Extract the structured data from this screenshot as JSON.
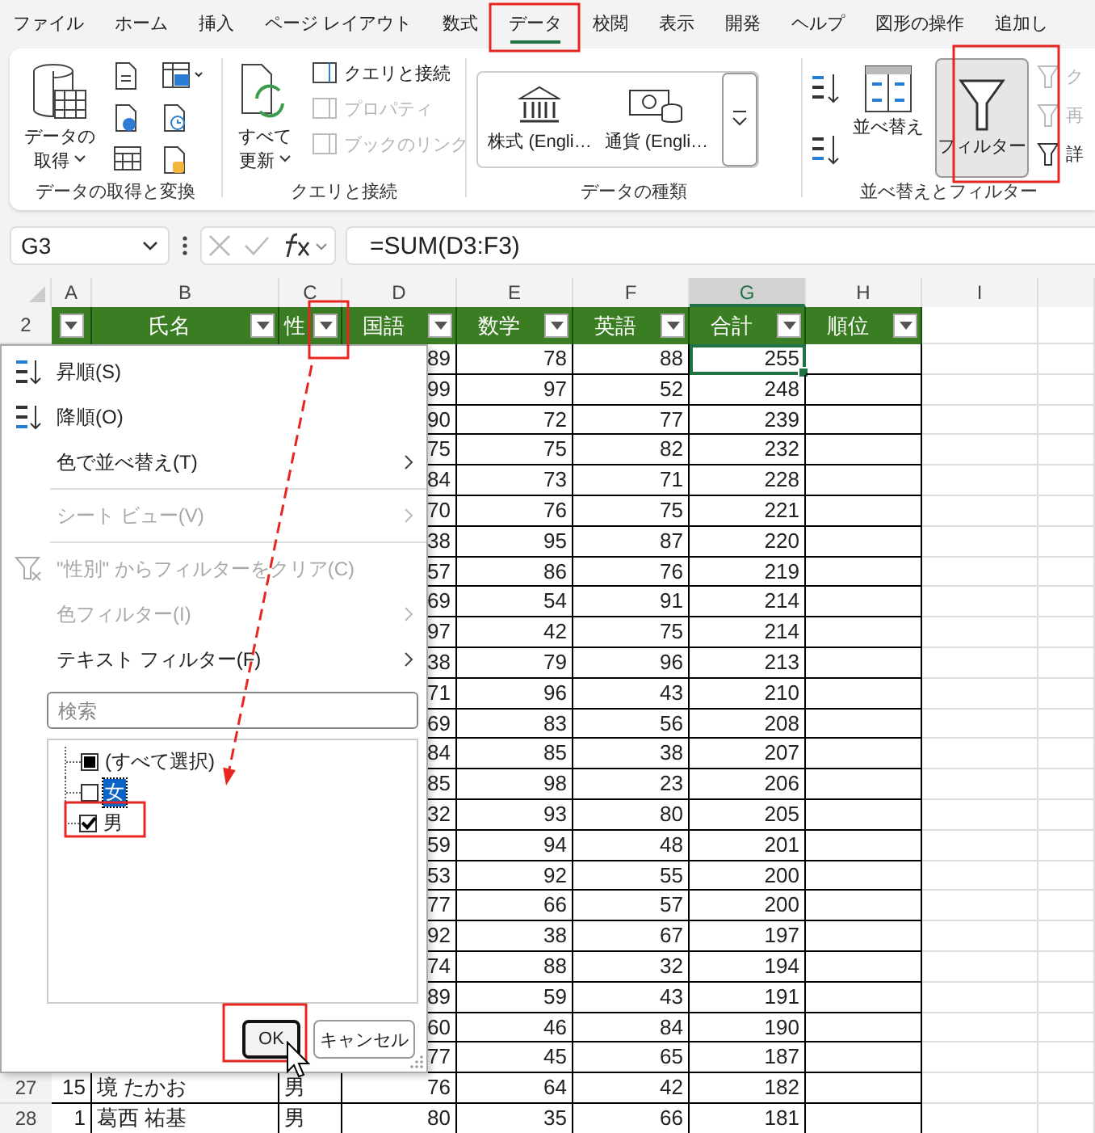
{
  "menu_tabs": [
    {
      "label": "ファイル",
      "selected": false
    },
    {
      "label": "ホーム",
      "selected": false
    },
    {
      "label": "挿入",
      "selected": false
    },
    {
      "label": "ページ レイアウト",
      "selected": false
    },
    {
      "label": "数式",
      "selected": false
    },
    {
      "label": "データ",
      "selected": true
    },
    {
      "label": "校閲",
      "selected": false
    },
    {
      "label": "表示",
      "selected": false
    },
    {
      "label": "開発",
      "selected": false
    },
    {
      "label": "ヘルプ",
      "selected": false
    },
    {
      "label": "図形の操作",
      "selected": false
    },
    {
      "label": "追加し",
      "selected": false
    }
  ],
  "ribbon": {
    "get_data_group": {
      "title": "データの取得と変換",
      "button_lines": [
        "データの",
        "取得"
      ]
    },
    "queries_group": {
      "title": "クエリと接続",
      "button_lines": [
        "すべて",
        "更新"
      ],
      "items": [
        {
          "label": "クエリと接続",
          "disabled": false
        },
        {
          "label": "プロパティ",
          "disabled": true
        },
        {
          "label": "ブックのリンク",
          "disabled": true
        }
      ]
    },
    "data_types_group": {
      "title": "データの種類",
      "types": [
        "株式 (Engli…",
        "通貨 (Engli…"
      ]
    },
    "sort_filter_group": {
      "title": "並べ替えとフィルター",
      "sort_button": "並べ替え",
      "filter_button": {
        "label": "フィルター",
        "selected": true
      },
      "side_items": [
        {
          "label": "ク",
          "disabled": true
        },
        {
          "label": "再",
          "disabled": true
        },
        {
          "label": "詳",
          "disabled": false
        }
      ]
    }
  },
  "formula_bar": {
    "name_box": "G3",
    "formula": "=SUM(D3:F3)"
  },
  "sheet": {
    "columns": [
      {
        "letter": "A",
        "selected": false
      },
      {
        "letter": "B",
        "selected": false
      },
      {
        "letter": "C",
        "selected": false
      },
      {
        "letter": "D",
        "selected": false
      },
      {
        "letter": "E",
        "selected": false
      },
      {
        "letter": "F",
        "selected": false
      },
      {
        "letter": "G",
        "selected": true
      },
      {
        "letter": "H",
        "selected": false
      },
      {
        "letter": "I",
        "selected": false
      }
    ],
    "header_row": {
      "row_number": "2",
      "labels": [
        "氏名",
        "性",
        "国語",
        "数学",
        "英語",
        "合計",
        "順位"
      ]
    },
    "rows": [
      {
        "cells": [
          "89",
          "78",
          "88",
          "255"
        ],
        "selected": true
      },
      {
        "cells": [
          "99",
          "97",
          "52",
          "248"
        ],
        "selected": false
      },
      {
        "cells": [
          "90",
          "72",
          "77",
          "239"
        ],
        "selected": false
      },
      {
        "cells": [
          "75",
          "75",
          "82",
          "232"
        ],
        "selected": false
      },
      {
        "cells": [
          "84",
          "73",
          "71",
          "228"
        ],
        "selected": false
      },
      {
        "cells": [
          "70",
          "76",
          "75",
          "221"
        ],
        "selected": false
      },
      {
        "cells": [
          "38",
          "95",
          "87",
          "220"
        ],
        "selected": false
      },
      {
        "cells": [
          "57",
          "86",
          "76",
          "219"
        ],
        "selected": false
      },
      {
        "cells": [
          "69",
          "54",
          "91",
          "214"
        ],
        "selected": false
      },
      {
        "cells": [
          "97",
          "42",
          "75",
          "214"
        ],
        "selected": false
      },
      {
        "cells": [
          "38",
          "79",
          "96",
          "213"
        ],
        "selected": false
      },
      {
        "cells": [
          "71",
          "96",
          "43",
          "210"
        ],
        "selected": false
      },
      {
        "cells": [
          "69",
          "83",
          "56",
          "208"
        ],
        "selected": false
      },
      {
        "cells": [
          "84",
          "85",
          "38",
          "207"
        ],
        "selected": false
      },
      {
        "cells": [
          "85",
          "98",
          "23",
          "206"
        ],
        "selected": false
      },
      {
        "cells": [
          "32",
          "93",
          "80",
          "205"
        ],
        "selected": false
      },
      {
        "cells": [
          "59",
          "94",
          "48",
          "201"
        ],
        "selected": false
      },
      {
        "cells": [
          "53",
          "92",
          "55",
          "200"
        ],
        "selected": false
      },
      {
        "cells": [
          "77",
          "66",
          "57",
          "200"
        ],
        "selected": false
      },
      {
        "cells": [
          "92",
          "38",
          "67",
          "197"
        ],
        "selected": false
      },
      {
        "cells": [
          "74",
          "88",
          "32",
          "194"
        ],
        "selected": false
      },
      {
        "cells": [
          "89",
          "59",
          "43",
          "191"
        ],
        "selected": false
      },
      {
        "cells": [
          "60",
          "46",
          "84",
          "190"
        ],
        "selected": false
      },
      {
        "cells": [
          "77",
          "45",
          "65",
          "187"
        ],
        "selected": false
      },
      {
        "row_number": "27",
        "no": "15",
        "name": "境 たかお",
        "gender": "男",
        "cells": [
          "76",
          "64",
          "42",
          "182"
        ],
        "selected": false
      },
      {
        "row_number": "28",
        "no": "1",
        "name": "葛西 祐基",
        "gender": "男",
        "cells": [
          "80",
          "35",
          "66",
          "181"
        ],
        "selected": false
      }
    ]
  },
  "filter_menu": {
    "items": [
      {
        "kind": "sort-asc",
        "label": "昇順(S)",
        "disabled": false,
        "submenu": false
      },
      {
        "kind": "sort-desc",
        "label": "降順(O)",
        "disabled": false,
        "submenu": false
      },
      {
        "kind": "item",
        "label": "色で並べ替え(T)",
        "disabled": false,
        "submenu": true
      },
      {
        "kind": "separator"
      },
      {
        "kind": "item",
        "label": "シート ビュー(V)",
        "disabled": true,
        "submenu": true
      },
      {
        "kind": "separator"
      },
      {
        "kind": "clear",
        "label": "\"性別\" からフィルターをクリア(C)",
        "disabled": true,
        "submenu": false
      },
      {
        "kind": "item",
        "label": "色フィルター(I)",
        "disabled": true,
        "submenu": true
      },
      {
        "kind": "item",
        "label": "テキスト フィルター(F)",
        "disabled": false,
        "submenu": true
      }
    ],
    "search": {
      "placeholder": "検索"
    },
    "values": [
      {
        "label": "(すべて選択)",
        "checked": false,
        "indeterminate": true,
        "selected": false
      },
      {
        "label": "女",
        "checked": false,
        "indeterminate": false,
        "selected": true
      },
      {
        "label": "男",
        "checked": true,
        "indeterminate": false,
        "selected": false
      }
    ],
    "buttons": [
      {
        "label": "OK",
        "default": true
      },
      {
        "label": "キャンセル",
        "default": false
      }
    ]
  }
}
